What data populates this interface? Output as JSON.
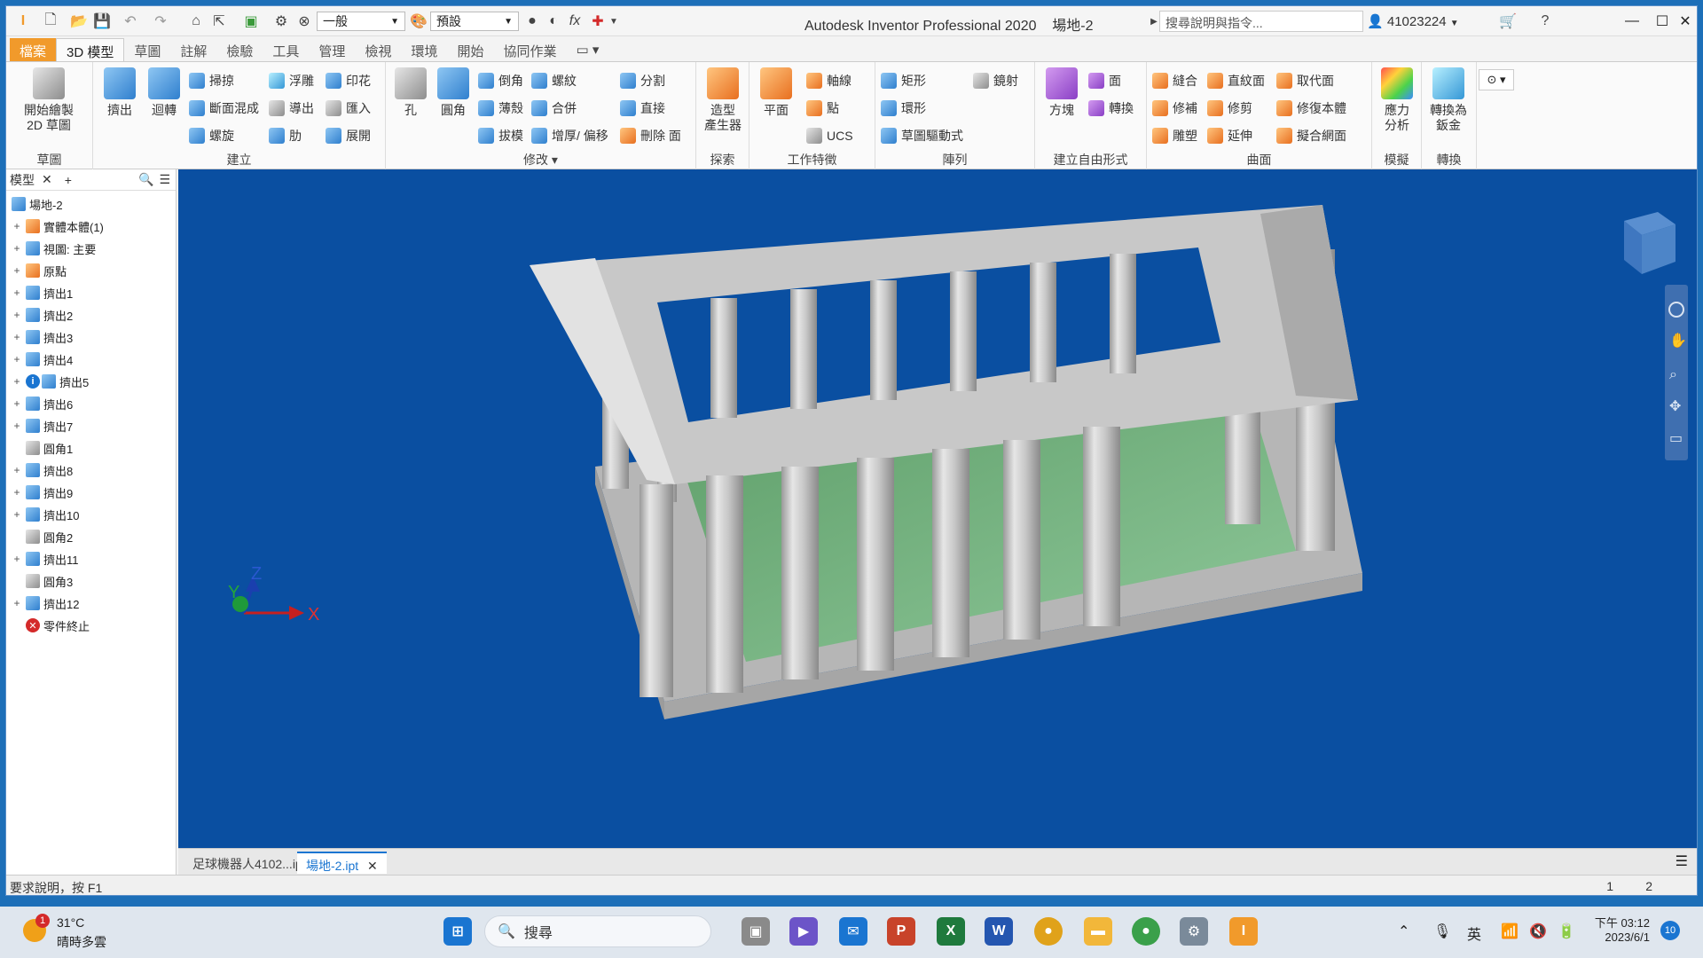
{
  "titlebar": {
    "style_combo": "一般",
    "appearance_combo": "預設",
    "app_title": "Autodesk Inventor Professional 2020",
    "doc_name": "場地-2",
    "search_placeholder": "搜尋說明與指令...",
    "user": "41023224"
  },
  "tabs": [
    "檔案",
    "3D 模型",
    "草圖",
    "註解",
    "檢驗",
    "工具",
    "管理",
    "檢視",
    "環境",
    "開始",
    "協同作業"
  ],
  "ribbon": {
    "sketch_panel": {
      "start_2d_sketch": "開始繪製",
      "start_2d_sketch_2": "2D 草圖",
      "label": "草圖"
    },
    "create_panel": {
      "extrude": "擠出",
      "revolve": "迴轉",
      "sweep": "掃掠",
      "loft": "斷面混成",
      "coil": "螺旋",
      "emboss": "浮雕",
      "derive": "導出",
      "rib": "肋",
      "decal": "印花",
      "import": "匯入",
      "unwrap": "展開",
      "label": "建立"
    },
    "modify_panel": {
      "hole": "孔",
      "fillet": "圓角",
      "chamfer": "倒角",
      "shell": "薄殼",
      "draft": "拔模",
      "thread": "螺紋",
      "combine": "合併",
      "thicken": "增厚/ 偏移",
      "split": "分割",
      "direct": "直接",
      "delete_face": "刪除 面",
      "label": "修改"
    },
    "explore_panel": {
      "shape_generator": "造型",
      "shape_generator_2": "產生器",
      "label": "探索"
    },
    "work_panel": {
      "plane": "平面",
      "axis": "軸線",
      "point": "點",
      "ucs": "UCS",
      "label": "工作特徵"
    },
    "pattern_panel": {
      "rectangular": "矩形",
      "circular": "環形",
      "sketch_driven": "草圖驅動式",
      "mirror": "鏡射",
      "label": "陣列"
    },
    "freeform_panel": {
      "box": "方塊",
      "face": "面",
      "convert": "轉換",
      "label": "建立自由形式"
    },
    "surface_panel": {
      "stitch": "縫合",
      "patch": "修補",
      "sculpt": "雕塑",
      "ruled": "直紋面",
      "trim": "修剪",
      "extend": "延伸",
      "replace_face": "取代面",
      "repair": "修復本體",
      "fit_mesh": "擬合網面",
      "label": "曲面"
    },
    "simulation_panel": {
      "stress": "應力",
      "stress_2": "分析",
      "label": "模擬"
    },
    "convert_panel": {
      "sheet_metal": "轉換為",
      "sheet_metal_2": "鈑金",
      "label": "轉換"
    }
  },
  "browser": {
    "tab_label": "模型",
    "root": "場地-2",
    "items": [
      "實體本體(1)",
      "視圖: 主要",
      "原點",
      "擠出1",
      "擠出2",
      "擠出3",
      "擠出4",
      "擠出5",
      "擠出6",
      "擠出7",
      "圓角1",
      "擠出8",
      "擠出9",
      "擠出10",
      "圓角2",
      "擠出11",
      "圓角3",
      "擠出12",
      "零件終止"
    ]
  },
  "viewport": {
    "axis_x": "X",
    "axis_y": "Y",
    "axis_z": "Z",
    "bg_color": "#0a4fa1"
  },
  "doctabs": {
    "tab1": "足球機器人4102...ipt",
    "tab2": "場地-2.ipt"
  },
  "status": {
    "help": "要求說明，按 F1",
    "page1": "1",
    "page2": "2"
  },
  "taskbar": {
    "temp": "31°C",
    "weather": "晴時多雲",
    "weather_badge": "1",
    "search": "搜尋",
    "ime": "英",
    "time": "下午 03:12",
    "date": "2023/6/1",
    "notif": "10"
  }
}
